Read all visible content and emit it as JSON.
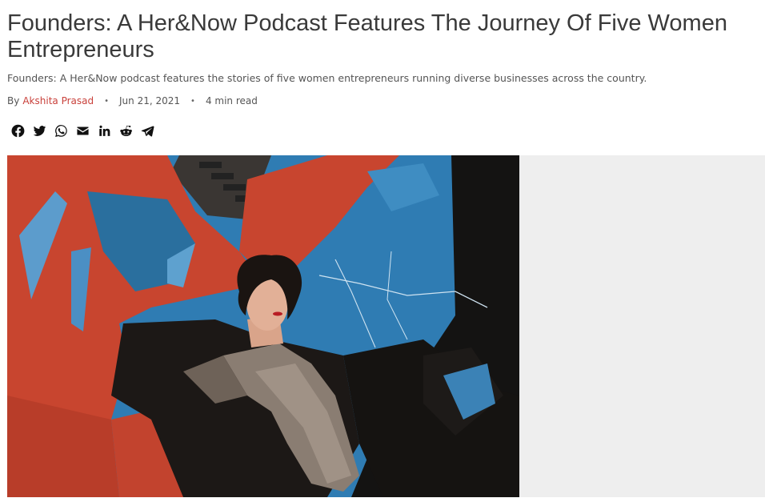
{
  "article": {
    "title": "Founders: A Her&Now Podcast Features The Journey Of Five Women Entrepreneurs",
    "subtitle": "Founders: A Her&Now podcast features the stories of five women entrepreneurs running diverse businesses across the country.",
    "by_label": "By",
    "author": "Akshita Prasad",
    "separator": "•",
    "date": "Jun 21, 2021",
    "read_time": "4 min read"
  },
  "share": {
    "icons": [
      "facebook-icon",
      "twitter-icon",
      "whatsapp-icon",
      "email-icon",
      "linkedin-icon",
      "reddit-icon",
      "telegram-icon"
    ]
  },
  "colors": {
    "author_link": "#c9413b",
    "sky_blue": "#2f7cb3",
    "red_panel": "#c8452f",
    "sidebar_bg": "#eeeeee"
  }
}
